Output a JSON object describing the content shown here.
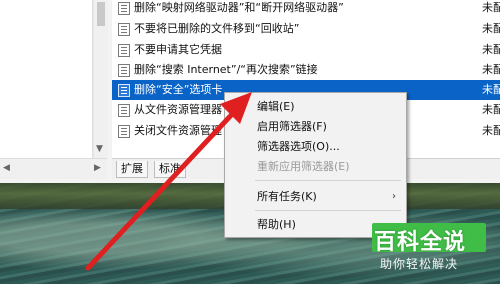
{
  "list": {
    "rows": [
      {
        "name": "删除“映射网络驱动器”和“断开网络驱动器”",
        "state": "未配"
      },
      {
        "name": "不要将已删除的文件移到“回收站”",
        "state": "未配"
      },
      {
        "name": "不要申请其它凭据",
        "state": "未配"
      },
      {
        "name": "删除“搜索 Internet”/“再次搜索”链接",
        "state": "未配"
      },
      {
        "name": "删除“安全”选项卡",
        "state": "未配"
      },
      {
        "name": "从文件资源管理器",
        "state": "未配"
      },
      {
        "name": "关闭文件资源管理",
        "state": "未配"
      }
    ]
  },
  "tabs": [
    "扩展",
    "标准"
  ],
  "context_menu": {
    "items": [
      {
        "label": "编辑(E)"
      },
      {
        "label": "启用筛选器(F)"
      },
      {
        "label": "筛选器选项(O)..."
      },
      {
        "label": "重新应用筛选器(E)"
      },
      {
        "label": "所有任务(K)",
        "submenu_glyph": "›"
      },
      {
        "label": "帮助(H)"
      }
    ]
  },
  "watermark": {
    "title": "百科全说",
    "subtitle": "助你轻松解决"
  },
  "colors": {
    "selection": "#0a64c8",
    "annotation_arrow": "#e02020",
    "watermark_badge": "#3fbd46"
  }
}
